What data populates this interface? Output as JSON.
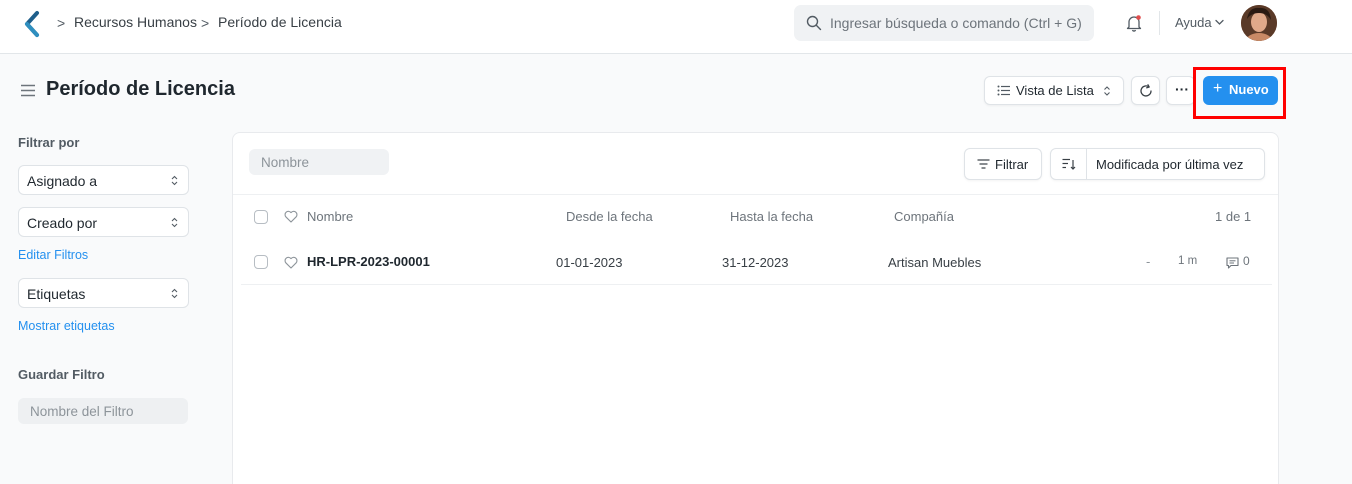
{
  "navbar": {
    "breadcrumbs": [
      "Recursos Humanos",
      "Período de Licencia"
    ],
    "breadcrumb_separator": ">",
    "search_placeholder": "Ingresar búsqueda o comando (Ctrl + G)",
    "help_label": "Ayuda",
    "logo_color": "#1f5f8b",
    "icons": [
      "search-icon",
      "bell-icon",
      "chevron-down-icon",
      "avatar"
    ]
  },
  "page": {
    "title": "Período de Licencia",
    "view_label": "Vista de Lista",
    "more_label": "···",
    "new_label": "Nuevo",
    "new_plus": "+",
    "accent_color": "#2490ef",
    "highlight_color": "#ff0000"
  },
  "sidebar": {
    "filter_heading": "Filtrar por",
    "assigned_to": "Asignado a",
    "created_by": "Creado por",
    "edit_filters": "Editar Filtros",
    "tags": "Etiquetas",
    "show_tags": "Mostrar etiquetas",
    "save_filter_heading": "Guardar Filtro",
    "filter_name_placeholder": "Nombre del Filtro"
  },
  "list": {
    "name_filter_placeholder": "Nombre",
    "filter_label": "Filtrar",
    "sort_label": "Modificada por última vez",
    "columns": [
      "Nombre",
      "Desde la fecha",
      "Hasta la fecha",
      "Compañía"
    ],
    "count": "1 de 1",
    "rows": [
      {
        "name": "HR-LPR-2023-00001",
        "from_date": "01-01-2023",
        "to_date": "31-12-2023",
        "company": "Artisan Muebles",
        "status": "-",
        "modified": "1 m",
        "comments": "0"
      }
    ]
  }
}
